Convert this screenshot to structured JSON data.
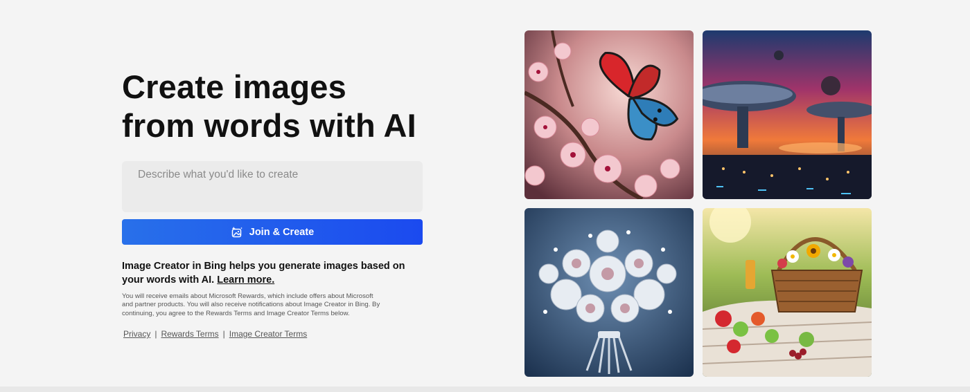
{
  "hero": {
    "headline": "Create images from words with AI"
  },
  "prompt": {
    "placeholder": "Describe what you'd like to create",
    "value": ""
  },
  "cta": {
    "label": "Join & Create",
    "icon": "image-sparkle-icon",
    "colors": [
      "#2870ea",
      "#1b4aef"
    ]
  },
  "description": {
    "text": "Image Creator in Bing helps you generate images based on your words with AI.",
    "learn_more": "Learn more."
  },
  "fine_print": "You will receive emails about Microsoft Rewards, which include offers about Microsoft and partner products. You will also receive notifications about Image Creator in Bing. By continuing, you agree to the Rewards Terms and Image Creator Terms below.",
  "footer_links": {
    "items": [
      "Privacy",
      "Rewards Terms",
      "Image Creator Terms"
    ],
    "separator": "|"
  },
  "gallery": [
    {
      "name": "butterfly-cherry-blossom-image"
    },
    {
      "name": "futuristic-space-city-image"
    },
    {
      "name": "silver-flower-bouquet-image"
    },
    {
      "name": "picnic-basket-meadow-image"
    }
  ]
}
